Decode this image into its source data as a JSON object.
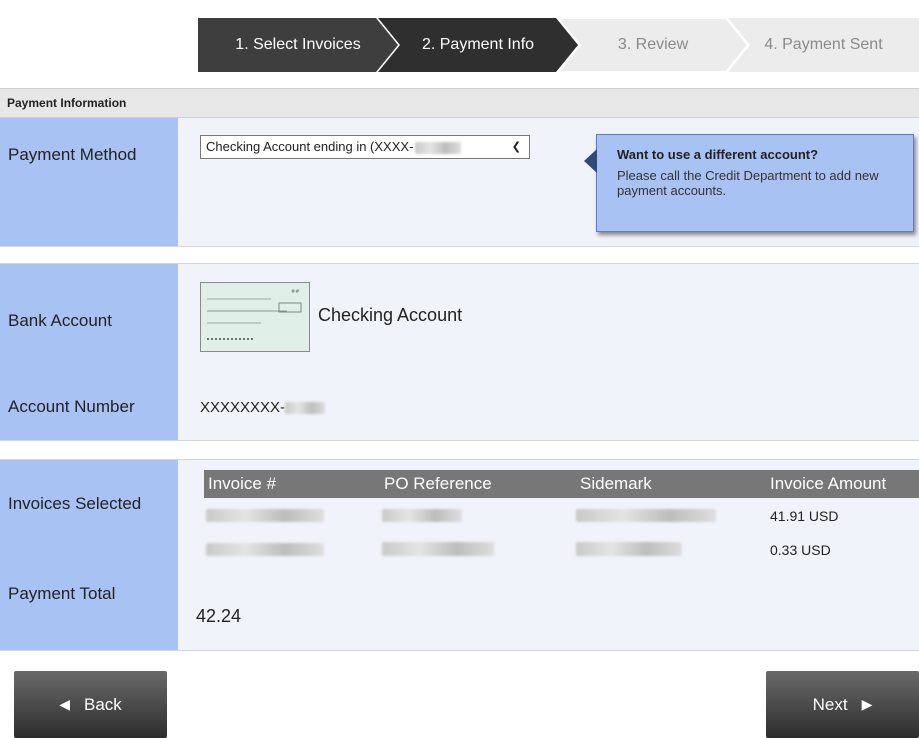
{
  "steps": [
    {
      "label": "1. Select Invoices",
      "state": "done"
    },
    {
      "label": "2. Payment Info",
      "state": "active"
    },
    {
      "label": "3. Review",
      "state": "pending"
    },
    {
      "label": "4. Payment Sent",
      "state": "pending"
    }
  ],
  "section_title": "Payment Information",
  "payment_method": {
    "label": "Payment Method",
    "selected": "Checking Account ending in (XXXX-",
    "callout_title": "Want to use a different account?",
    "callout_text": "Please call the Credit Department to add new payment accounts."
  },
  "bank_account": {
    "label": "Bank Account",
    "value": "Checking Account"
  },
  "account_number": {
    "label": "Account Number",
    "value": "XXXXXXXX-"
  },
  "invoices": {
    "label": "Invoices Selected",
    "columns": [
      "Invoice #",
      "PO Reference",
      "Sidemark",
      "Invoice Amount"
    ],
    "rows": [
      {
        "amount": "41.91 USD"
      },
      {
        "amount": "0.33 USD"
      }
    ]
  },
  "payment_total": {
    "label": "Payment Total",
    "value": "42.24"
  },
  "buttons": {
    "back": "Back",
    "next": "Next"
  },
  "colors": {
    "label_bg": "#a8c2f3",
    "body_bg": "#f1f3fa",
    "step_active": "#3a3a3a",
    "step_inactive": "#ebebeb"
  }
}
